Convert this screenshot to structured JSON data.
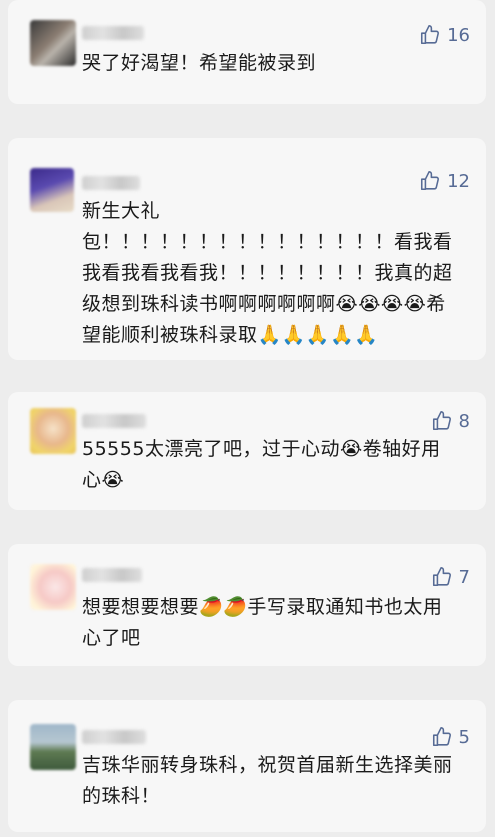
{
  "comments": [
    {
      "likes": "16",
      "text": "哭了好渴望！希望能被录到"
    },
    {
      "likes": "12",
      "text": "新生大礼\n包！！！！！！！！！！！！！！！看我看我看我看我看我！！！！！！！！我真的超级想到珠科读书啊啊啊啊啊啊😭😭😭😭希望能顺利被珠科录取🙏🙏🙏🙏🙏"
    },
    {
      "likes": "8",
      "text": "55555太漂亮了吧，过于心动😭卷轴好用心😭"
    },
    {
      "likes": "7",
      "text": "想要想要想要🥭🥭手写录取通知书也太用心了吧"
    },
    {
      "likes": "5",
      "text": "吉珠华丽转身珠科，祝贺首届新生选择美丽的珠科！"
    }
  ],
  "colors": {
    "like": "#576b95",
    "card": "#f7f7f7",
    "page": "#ededed"
  },
  "icons": {
    "like": "thumbs-up-outline-icon"
  }
}
